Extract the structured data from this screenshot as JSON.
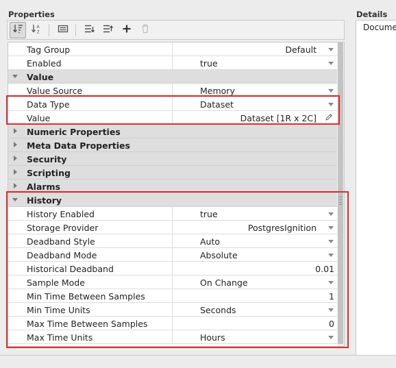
{
  "properties_panel": {
    "title": "Properties",
    "toolbar": [
      {
        "icon": "sort-categorized-icon",
        "tooltip": ""
      },
      {
        "icon": "sort-alphabetical-icon",
        "tooltip": ""
      },
      {
        "icon": "show-descriptions-icon",
        "tooltip": ""
      },
      {
        "icon": "expand-all-icon",
        "tooltip": ""
      },
      {
        "icon": "collapse-all-icon",
        "tooltip": ""
      },
      {
        "icon": "add-icon",
        "tooltip": ""
      },
      {
        "icon": "delete-icon",
        "tooltip": ""
      }
    ],
    "rows": [
      {
        "type": "prop",
        "name": "Tag Group",
        "value": "Default",
        "align": "right",
        "dropdown": true
      },
      {
        "type": "prop",
        "name": "Enabled",
        "value": "true",
        "align": "left",
        "dropdown": true
      },
      {
        "type": "cat",
        "name": "Value",
        "expanded": true
      },
      {
        "type": "prop",
        "name": "Value Source",
        "value": "Memory",
        "align": "left",
        "dropdown": true
      },
      {
        "type": "prop",
        "name": "Data Type",
        "value": "Dataset",
        "align": "left",
        "dropdown": true
      },
      {
        "type": "prop",
        "name": "Value",
        "value": "Dataset [1R x 2C]",
        "align": "right",
        "dropdown": false,
        "editor": "pencil-icon"
      },
      {
        "type": "cat",
        "name": "Numeric Properties",
        "expanded": false
      },
      {
        "type": "cat",
        "name": "Meta Data Properties",
        "expanded": false
      },
      {
        "type": "cat",
        "name": "Security",
        "expanded": false
      },
      {
        "type": "cat",
        "name": "Scripting",
        "expanded": false
      },
      {
        "type": "cat",
        "name": "Alarms",
        "expanded": false
      },
      {
        "type": "cat",
        "name": "History",
        "expanded": true
      },
      {
        "type": "prop",
        "name": "History Enabled",
        "value": "true",
        "align": "left",
        "dropdown": true
      },
      {
        "type": "prop",
        "name": "Storage Provider",
        "value": "PostgresIgnition",
        "align": "right",
        "dropdown": true
      },
      {
        "type": "prop",
        "name": "Deadband Style",
        "value": "Auto",
        "align": "left",
        "dropdown": true
      },
      {
        "type": "prop",
        "name": "Deadband Mode",
        "value": "Absolute",
        "align": "left",
        "dropdown": true
      },
      {
        "type": "prop",
        "name": "Historical Deadband",
        "value": "0.01",
        "align": "right",
        "dropdown": false
      },
      {
        "type": "prop",
        "name": "Sample Mode",
        "value": "On Change",
        "align": "left",
        "dropdown": true
      },
      {
        "type": "prop",
        "name": "Min Time Between Samples",
        "value": "1",
        "align": "right",
        "dropdown": false
      },
      {
        "type": "prop",
        "name": "Min Time Units",
        "value": "Seconds",
        "align": "left",
        "dropdown": true
      },
      {
        "type": "prop",
        "name": "Max Time Between Samples",
        "value": "0",
        "align": "right",
        "dropdown": false
      },
      {
        "type": "prop",
        "name": "Max Time Units",
        "value": "Hours",
        "align": "left",
        "dropdown": true
      }
    ]
  },
  "details_panel": {
    "title": "Details",
    "text": "Docume"
  },
  "colors": {
    "highlight": "#e12b2b",
    "category_bg": "#dedede"
  }
}
